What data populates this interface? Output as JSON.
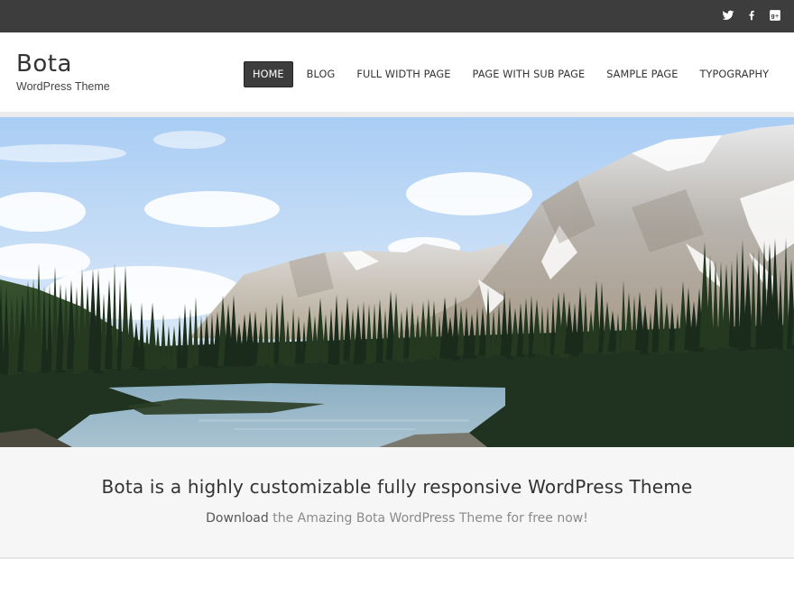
{
  "topbar": {
    "social": [
      {
        "name": "twitter",
        "icon": "twitter-icon"
      },
      {
        "name": "facebook",
        "icon": "facebook-icon"
      },
      {
        "name": "google-plus",
        "icon": "google-plus-icon"
      }
    ]
  },
  "header": {
    "site_title": "Bota",
    "site_description": "WordPress Theme"
  },
  "nav": {
    "items": [
      {
        "label": "HOME",
        "active": true
      },
      {
        "label": "BLOG",
        "active": false
      },
      {
        "label": "FULL WIDTH PAGE",
        "active": false
      },
      {
        "label": "PAGE WITH SUB PAGE",
        "active": false
      },
      {
        "label": "SAMPLE PAGE",
        "active": false
      },
      {
        "label": "TYPOGRAPHY",
        "active": false
      }
    ]
  },
  "hero": {
    "description": "Mountain lake landscape with snowy peaks and pine forest"
  },
  "tagline": {
    "heading": "Bota is a highly customizable fully responsive WordPress Theme",
    "link_text": "Download",
    "rest_text": " the Amazing Bota WordPress Theme for free now!"
  },
  "colors": {
    "topbar_bg": "#3d3d3d",
    "active_nav_bg": "#3d3d3d",
    "tagline_bg": "#f6f6f6"
  }
}
